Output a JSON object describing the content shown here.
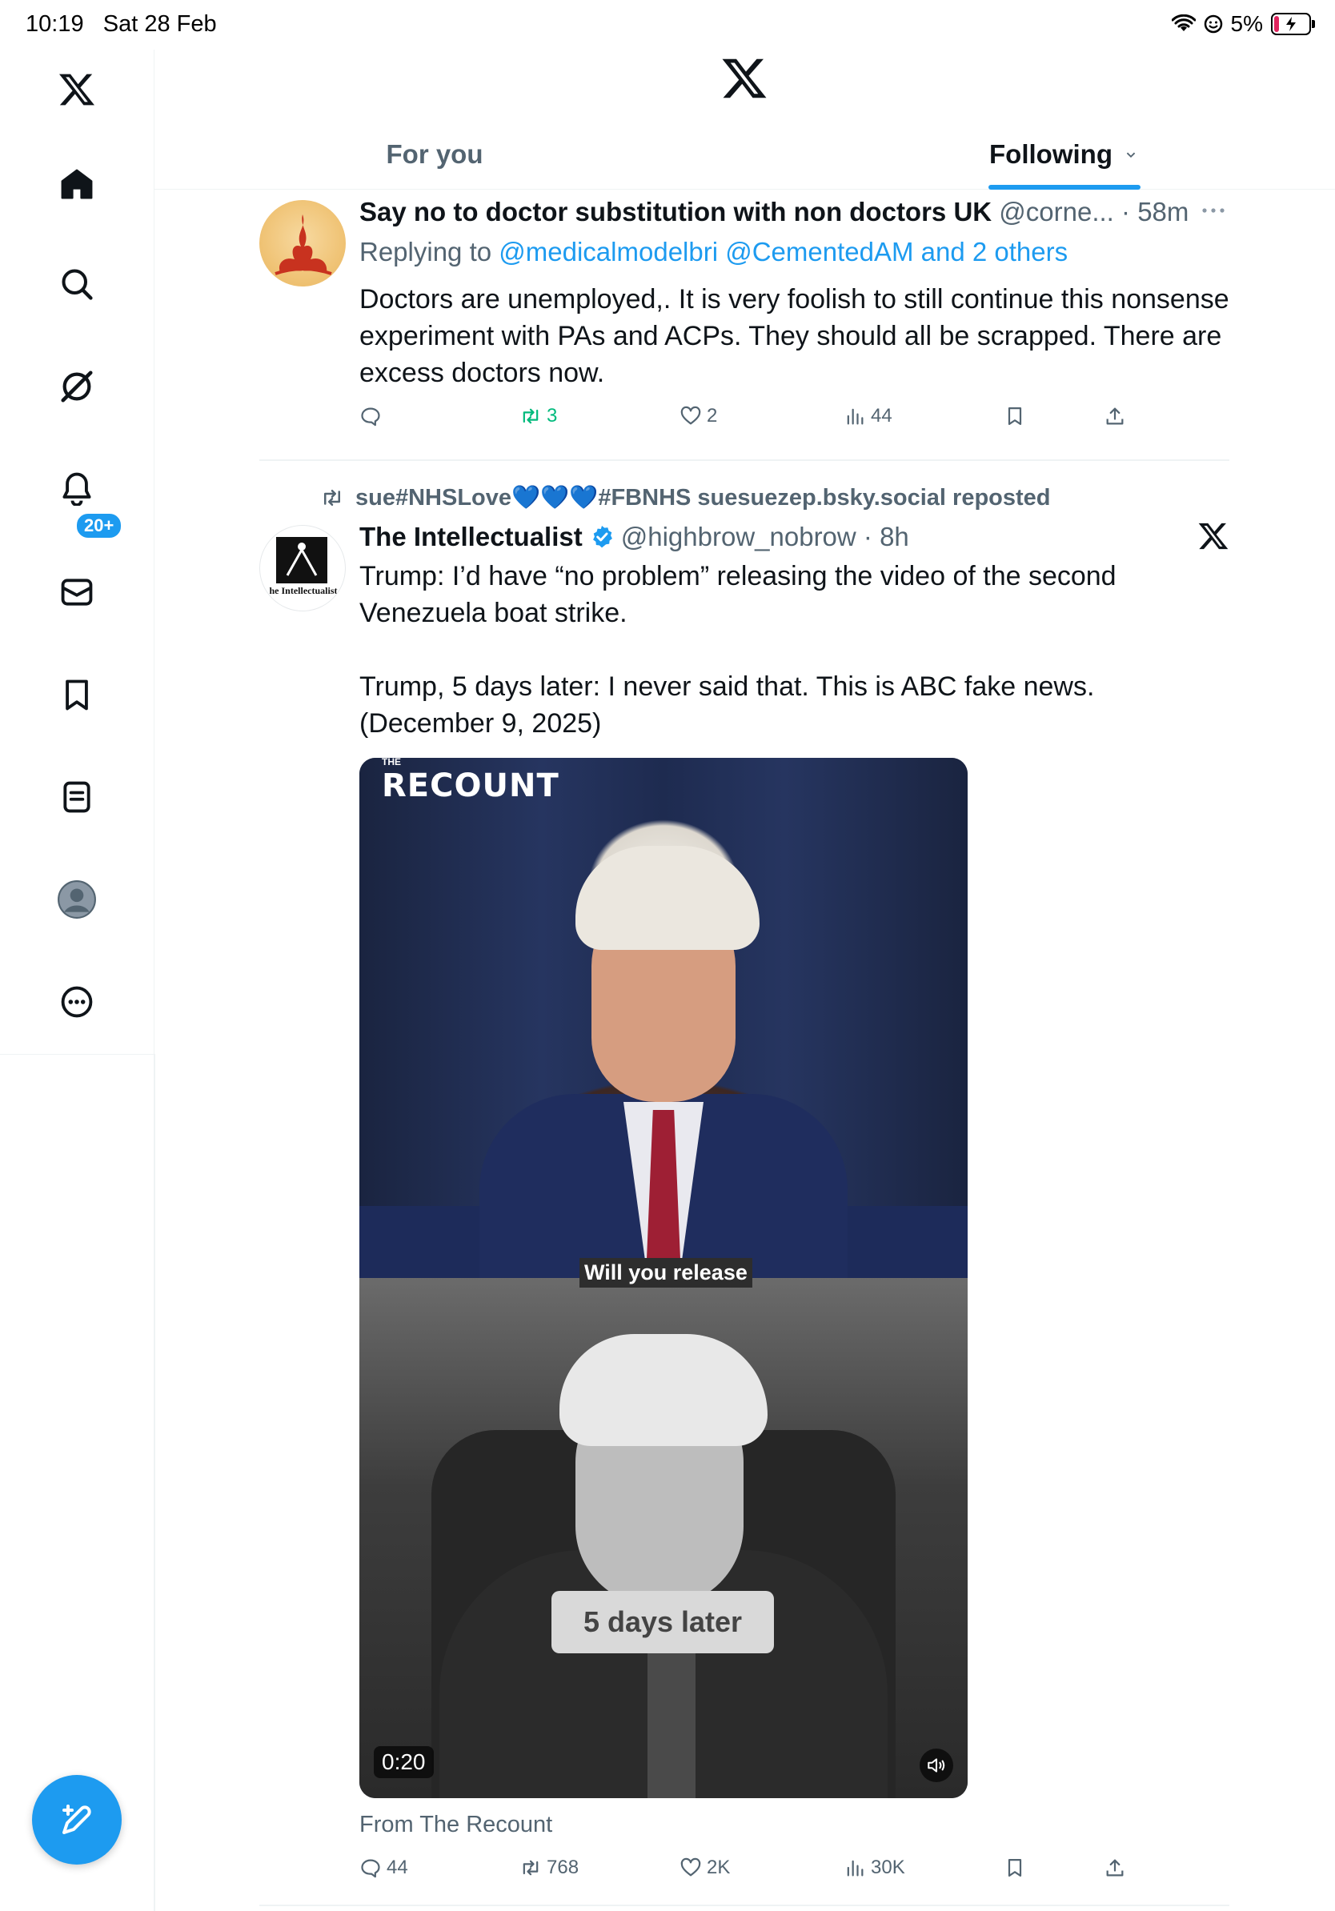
{
  "status_bar": {
    "time": "10:19",
    "date": "Sat 28 Feb",
    "battery": "5%"
  },
  "sidebar": {
    "items": [
      {
        "name": "home"
      },
      {
        "name": "explore"
      },
      {
        "name": "grok"
      },
      {
        "name": "notifications",
        "badge": "20+"
      },
      {
        "name": "messages"
      },
      {
        "name": "bookmarks"
      },
      {
        "name": "lists"
      },
      {
        "name": "profile"
      },
      {
        "name": "more"
      }
    ]
  },
  "tabs": [
    {
      "label": "For you",
      "active": false
    },
    {
      "label": "Following",
      "active": true
    }
  ],
  "posts": [
    {
      "display_name": "Say no to doctor substitution with non doctors UK",
      "handle": "@corne...",
      "time": "58m",
      "reply_prefix": "Replying to",
      "reply_targets": "@medicalmodelbri @CementedAM and 2 others",
      "text": "Doctors are unemployed,. It is very foolish to still continue this nonsense experiment with PAs and ACPs. They should all be scrapped. There are excess doctors now.",
      "replies": "",
      "reposts": "3",
      "likes": "2",
      "views": "44"
    },
    {
      "repost_by": "sue#NHSLove💙💙💙#FBNHS suesuezep.bsky.social reposted",
      "display_name": "The Intellectualist",
      "handle": "@highbrow_nobrow",
      "time": "8h",
      "avatar_text": "he Intellectualist",
      "text": "Trump: I’d have “no problem” releasing the video of the second Venezuela boat strike.\n\nTrump, 5 days later: I never said that. This is ABC fake news. (December 9, 2025)",
      "video": {
        "watermark": "RECOUNT",
        "watermark_small": "THE",
        "caption": "Will you release",
        "overlay": "5 days later",
        "duration": "0:20"
      },
      "source": "From The Recount",
      "replies": "44",
      "reposts": "768",
      "likes": "2K",
      "views": "30K"
    }
  ],
  "colors": {
    "accent": "#1d9bf0",
    "repost_green": "#00ba7c",
    "text": "#0f1419",
    "muted": "#536471"
  }
}
